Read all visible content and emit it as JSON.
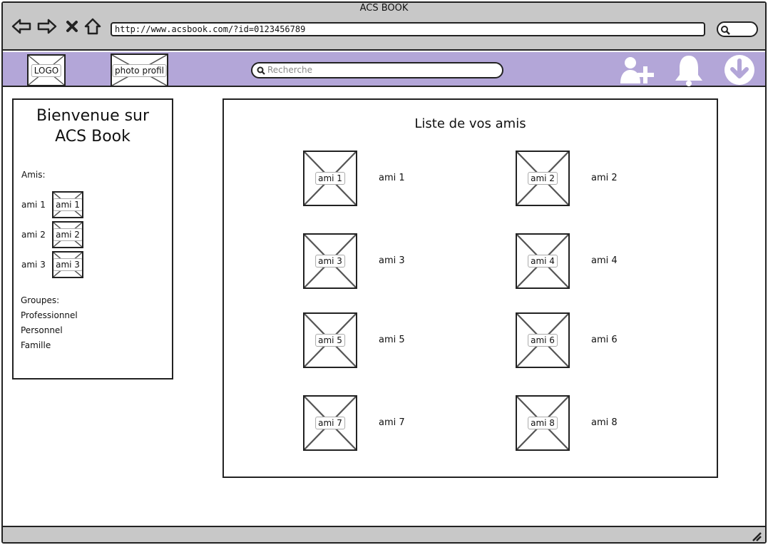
{
  "window": {
    "title": "ACS BOOK"
  },
  "browser": {
    "url": "http://www.acsbook.com/?id=0123456789",
    "icons": [
      "back-arrow-icon",
      "forward-arrow-icon",
      "close-icon",
      "home-icon",
      "search-icon"
    ]
  },
  "header": {
    "logo_label": "LOGO",
    "profile_photo_label": "photo profil",
    "search_placeholder": "Recherche",
    "icons": [
      "add-friend-icon",
      "notification-bell-icon",
      "download-icon"
    ],
    "icon_color": "#ffffff",
    "background_color": "#b3a6d8"
  },
  "sidebar": {
    "welcome_line1": "Bienvenue sur",
    "welcome_line2": "ACS Book",
    "friends_heading": "Amis:",
    "friends": [
      {
        "name": "ami 1",
        "photo_label": "ami 1"
      },
      {
        "name": "ami 2",
        "photo_label": "ami 2"
      },
      {
        "name": "ami 3",
        "photo_label": "ami 3"
      }
    ],
    "groups_heading": "Groupes:",
    "groups": [
      "Professionnel",
      "Personnel",
      "Famille"
    ]
  },
  "main": {
    "title": "Liste de vos amis",
    "friends": [
      {
        "name": "ami 1",
        "photo_label": "ami 1"
      },
      {
        "name": "ami 2",
        "photo_label": "ami 2"
      },
      {
        "name": "ami 3",
        "photo_label": "ami 3"
      },
      {
        "name": "ami 4",
        "photo_label": "ami 4"
      },
      {
        "name": "ami 5",
        "photo_label": "ami 5"
      },
      {
        "name": "ami 6",
        "photo_label": "ami 6"
      },
      {
        "name": "ami 7",
        "photo_label": "ami 7"
      },
      {
        "name": "ami 8",
        "photo_label": "ami 8"
      }
    ]
  }
}
